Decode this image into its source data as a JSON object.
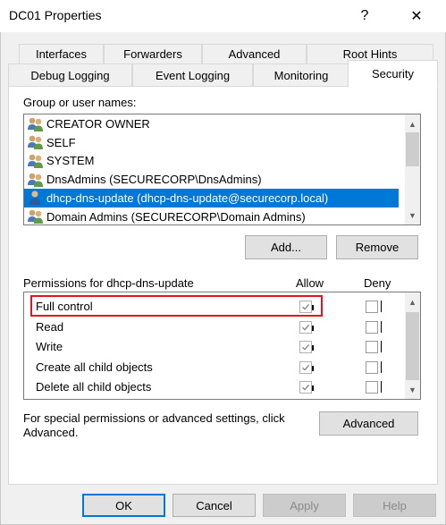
{
  "window": {
    "title": "DC01 Properties",
    "help_glyph": "?",
    "close_glyph": "✕"
  },
  "tabs_row1": [
    "Interfaces",
    "Forwarders",
    "Advanced",
    "Root Hints"
  ],
  "tabs_row2": [
    "Debug Logging",
    "Event Logging",
    "Monitoring",
    "Security"
  ],
  "active_tab": "Security",
  "security": {
    "group_label": "Group or user names:",
    "users": [
      {
        "name": "CREATOR OWNER",
        "icon": "group-icon",
        "selected": false
      },
      {
        "name": "SELF",
        "icon": "group-icon",
        "selected": false
      },
      {
        "name": "SYSTEM",
        "icon": "group-icon",
        "selected": false
      },
      {
        "name": "DnsAdmins (SECURECORP\\DnsAdmins)",
        "icon": "group-icon",
        "selected": false
      },
      {
        "name": "dhcp-dns-update (dhcp-dns-update@securecorp.local)",
        "icon": "user-icon",
        "selected": true
      },
      {
        "name": "Domain Admins (SECURECORP\\Domain Admins)",
        "icon": "group-icon",
        "selected": false
      }
    ],
    "add_label": "Add...",
    "remove_label": "Remove",
    "permissions_label": "Permissions for dhcp-dns-update",
    "allow_header": "Allow",
    "deny_header": "Deny",
    "permissions": [
      {
        "name": "Full control",
        "allow": true,
        "deny": false,
        "highlighted": true
      },
      {
        "name": "Read",
        "allow": true,
        "deny": false,
        "highlighted": false
      },
      {
        "name": "Write",
        "allow": true,
        "deny": false,
        "highlighted": false
      },
      {
        "name": "Create all child objects",
        "allow": true,
        "deny": false,
        "highlighted": false
      },
      {
        "name": "Delete all child objects",
        "allow": true,
        "deny": false,
        "highlighted": false
      }
    ],
    "special_text": "For special permissions or advanced settings, click Advanced.",
    "advanced_label": "Advanced"
  },
  "footer": {
    "ok": "OK",
    "cancel": "Cancel",
    "apply": "Apply",
    "help": "Help"
  },
  "colors": {
    "selection": "#0078d7",
    "highlight_border": "#e81123"
  }
}
